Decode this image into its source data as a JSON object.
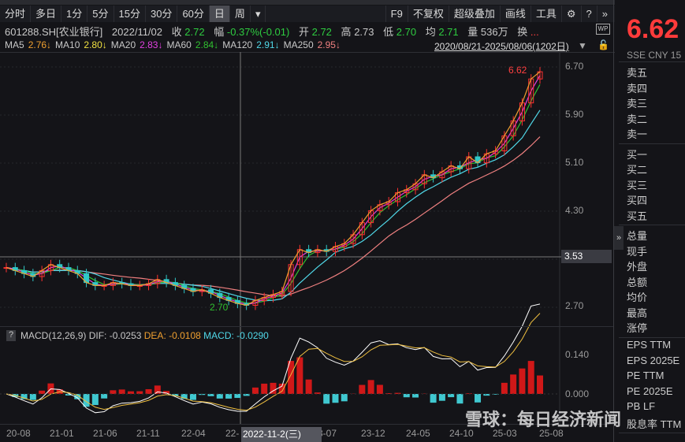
{
  "toolbar": {
    "periods": [
      "分时",
      "多日",
      "1分",
      "5分",
      "15分",
      "30分",
      "60分",
      "日",
      "周"
    ],
    "active": "日",
    "more": "▾",
    "right": [
      "F9",
      "不复权",
      "超级叠加",
      "画线",
      "工具"
    ],
    "settings_icon": "⚙",
    "help_icon": "?",
    "expand": "»"
  },
  "quote": {
    "code": "601288.SH[农业银行]",
    "date": "2022/11/02",
    "close_label": "收",
    "close": "2.72",
    "chg_label": "幅",
    "chg": "-0.37%(-0.01)",
    "open_label": "开",
    "open": "2.72",
    "high_label": "高",
    "high": "2.73",
    "low_label": "低",
    "low": "2.70",
    "avg_label": "均",
    "avg": "2.71",
    "vol_label": "量",
    "vol": "536万",
    "turn_label": "换",
    "turn": "...",
    "wp": "WP"
  },
  "ma": [
    {
      "label": "MA5",
      "value": "2.76↓",
      "color": "#f0a030"
    },
    {
      "label": "MA10",
      "value": "2.80↓",
      "color": "#f0e040"
    },
    {
      "label": "MA20",
      "value": "2.83↓",
      "color": "#e040e0"
    },
    {
      "label": "MA60",
      "value": "2.84↓",
      "color": "#30c030"
    },
    {
      "label": "MA120",
      "value": "2.91↓",
      "color": "#50d8e8"
    },
    {
      "label": "MA250",
      "value": "2.95↓",
      "color": "#f08080"
    }
  ],
  "range": "2020/08/21-2025/08/06(1202日)",
  "price_axis": [
    "6.70",
    "5.90",
    "5.10",
    "4.30",
    "3.53",
    "2.70"
  ],
  "crosshair_price": "3.53",
  "annot": {
    "high": "6.62",
    "low": "2.70"
  },
  "macd": {
    "help": "?",
    "title": "MACD(12,26,9)",
    "dif": "DIF: -0.0253",
    "dea": "DEA: -0.0108",
    "macd": "MACD: -0.0290",
    "axis": [
      "0.140",
      "0.000"
    ]
  },
  "dates": [
    "20-08",
    "21-01",
    "21-06",
    "21-11",
    "22-04",
    "22-",
    "2022-11-2(三)",
    "3-07",
    "23-12",
    "24-05",
    "24-10",
    "25-03",
    "25-08"
  ],
  "panel": {
    "price": "6.62",
    "exch": "SSE  CNY  15",
    "sell": [
      "卖五",
      "卖四",
      "卖三",
      "卖二",
      "卖一"
    ],
    "buy": [
      "买一",
      "买二",
      "买三",
      "买四",
      "买五"
    ],
    "stats": [
      "总量",
      "现手",
      "外盘",
      "总额",
      "均价",
      "最高",
      "涨停"
    ],
    "fin": [
      "EPS TTM",
      "EPS 2025E",
      "PE TTM",
      "PE 2025E",
      "PB LF",
      "股息率 TTM"
    ]
  },
  "watermark": "雪球：每日经济新闻",
  "chart_data": {
    "type": "line",
    "x_start": "2020-08",
    "x_end": "2025-08",
    "step": "month",
    "closes": [
      3.35,
      3.3,
      3.25,
      3.2,
      3.3,
      3.4,
      3.35,
      3.3,
      3.25,
      3.1,
      3.05,
      3.05,
      3.1,
      3.08,
      3.05,
      3.05,
      3.08,
      3.15,
      3.1,
      3.05,
      3.0,
      2.95,
      2.98,
      2.92,
      2.85,
      2.8,
      2.75,
      2.72,
      2.8,
      2.85,
      2.9,
      2.95,
      3.4,
      3.65,
      3.6,
      3.65,
      3.62,
      3.7,
      3.75,
      3.9,
      4.1,
      4.3,
      4.4,
      4.45,
      4.6,
      4.65,
      4.75,
      4.9,
      4.85,
      4.95,
      5.05,
      5.0,
      5.2,
      5.1,
      5.25,
      5.3,
      5.55,
      5.8,
      6.1,
      6.5,
      6.62
    ],
    "ylim": [
      2.5,
      6.9
    ]
  }
}
